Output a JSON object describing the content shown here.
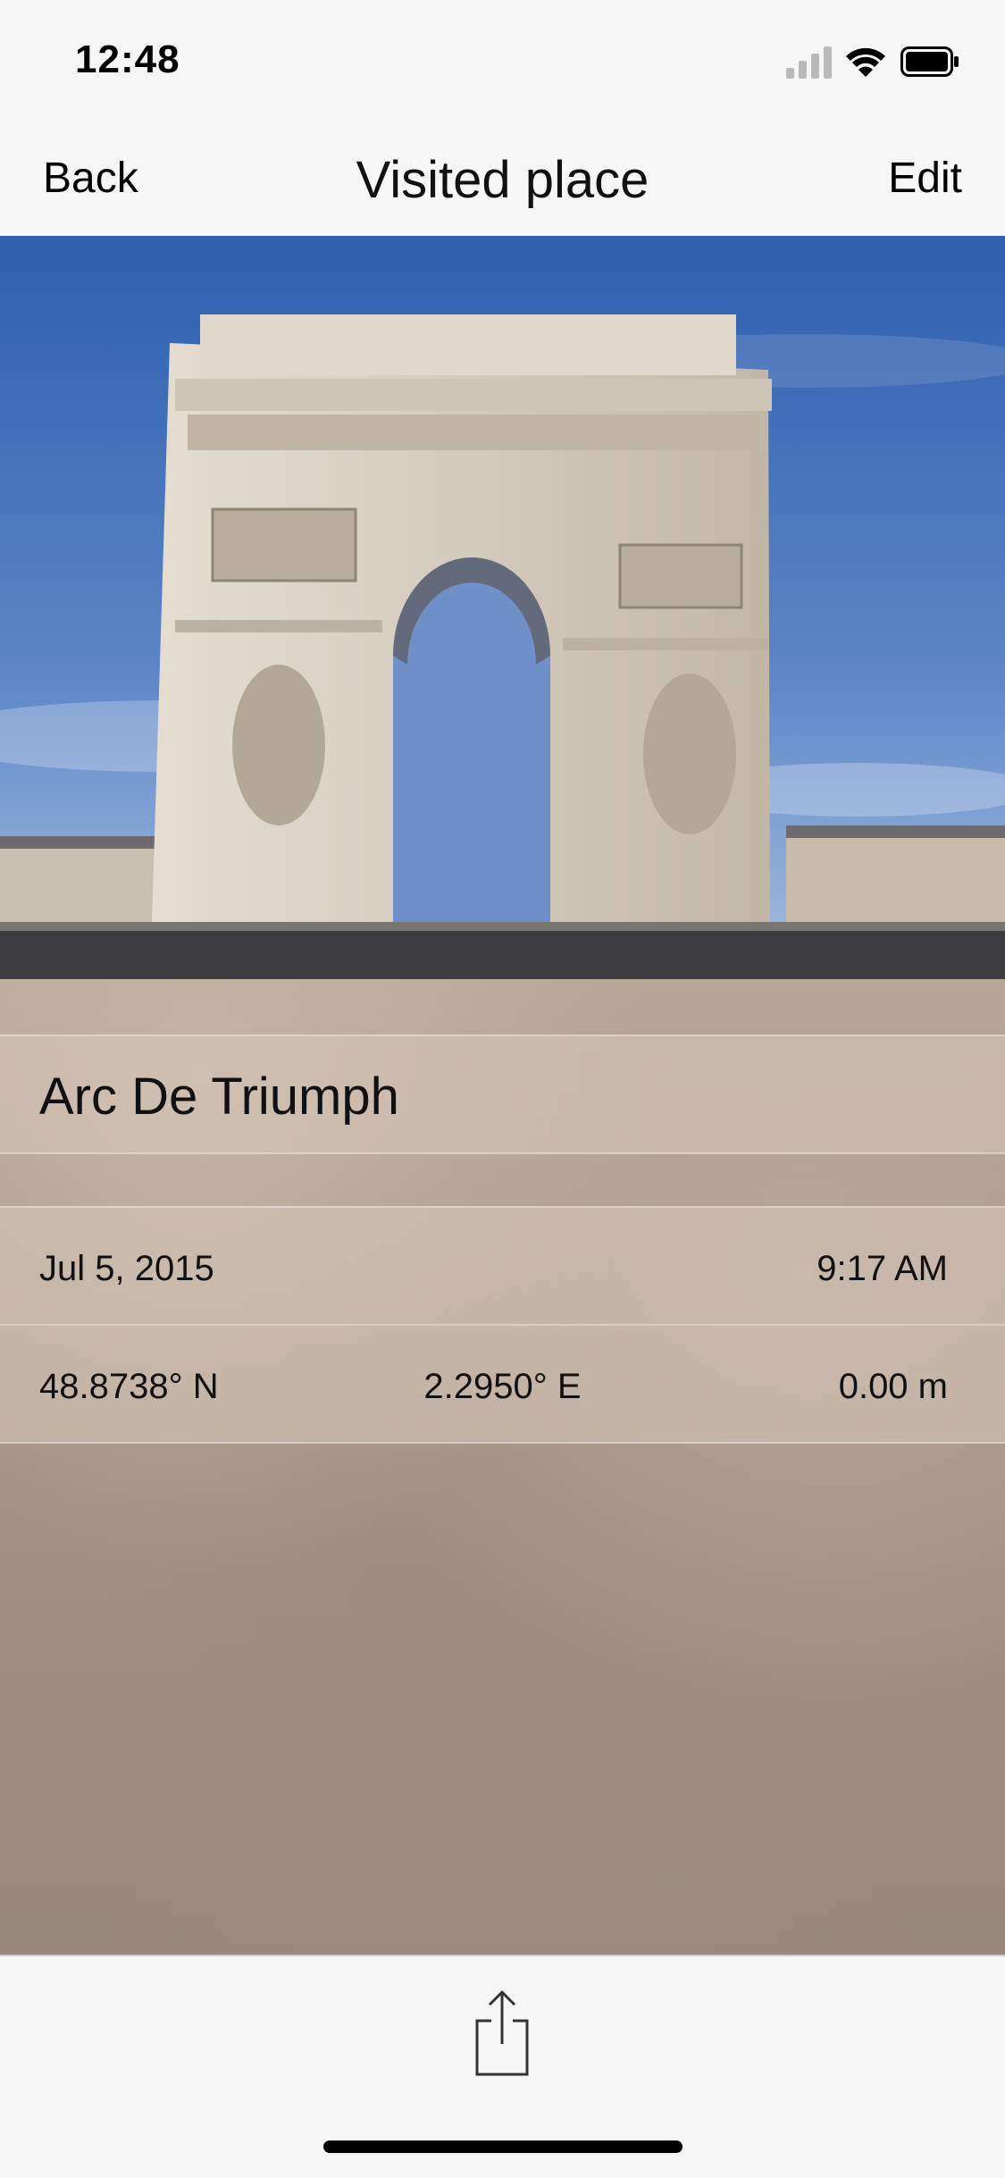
{
  "status_bar": {
    "time": "12:48"
  },
  "nav": {
    "back_label": "Back",
    "title": "Visited place",
    "edit_label": "Edit"
  },
  "place": {
    "name": "Arc De Triumph",
    "date": "Jul 5, 2015",
    "time": "9:17 AM",
    "latitude": "48.8738° N",
    "longitude": "2.2950° E",
    "altitude": "0.00 m"
  },
  "toolbar": {
    "share_icon": "share-icon"
  },
  "colors": {
    "sky": "#3f6fb8",
    "stone": "#d9d1c4",
    "backdrop": "#a8978a",
    "bar_bg": "#f6f6f6"
  }
}
